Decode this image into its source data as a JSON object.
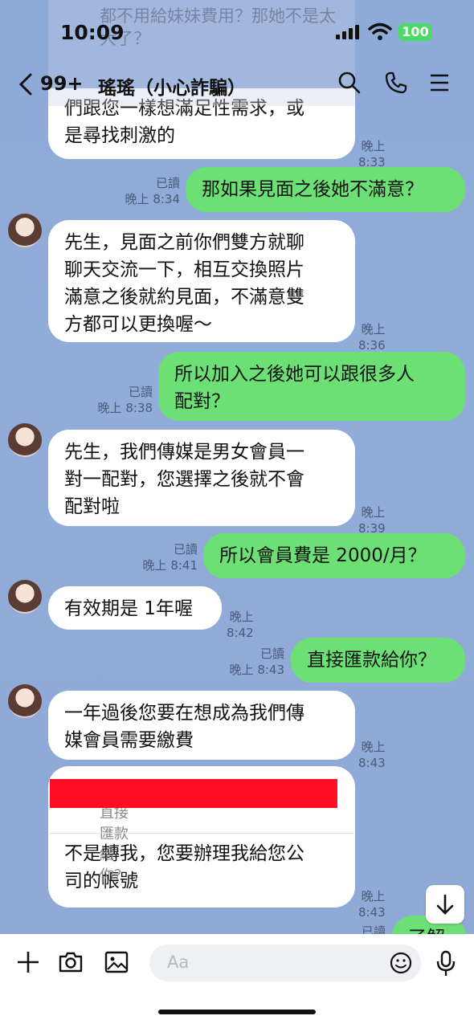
{
  "status_bar": {
    "time": "10:09",
    "battery": "100"
  },
  "header": {
    "unread_count": "99+",
    "title": "瑤瑤（小心詐騙）"
  },
  "ghost_overlay": {
    "text": "都不用給妹妹費用？那她不是太大了？"
  },
  "messages": [
    {
      "side": "left",
      "lines": [
        "們跟您一樣想滿足性需求，或",
        "是尋找刺激的"
      ],
      "time": "晚上 8:33"
    },
    {
      "side": "right",
      "lines": [
        "那如果見面之後她不滿意？"
      ],
      "read": "已讀",
      "time": "晚上 8:34"
    },
    {
      "side": "left",
      "lines": [
        "先生，見面之前你們雙方就聊",
        "聊天交流一下，相互交換照片",
        "滿意之後就約見面，不滿意雙",
        "方都可以更換喔～"
      ],
      "time": "晚上 8:36"
    },
    {
      "side": "right",
      "lines": [
        "所以加入之後她可以跟很多人",
        "配對？"
      ],
      "read": "已讀",
      "time": "晚上 8:38"
    },
    {
      "side": "left",
      "lines": [
        "先生，我們傳媒是男女會員一",
        "對一配對，您選擇之後就不會",
        "配對啦"
      ],
      "time": "晚上 8:39"
    },
    {
      "side": "right",
      "lines": [
        "所以會員費是 2000/月？"
      ],
      "read": "已讀",
      "time": "晚上 8:41"
    },
    {
      "side": "left",
      "lines": [
        "有效期是 1年喔"
      ],
      "time": "晚上 8:42"
    },
    {
      "side": "right",
      "lines": [
        "直接匯款給你？"
      ],
      "read": "已讀",
      "time": "晚上 8:43"
    },
    {
      "side": "left",
      "lines": [
        "一年過後您要在想成為我們傳",
        "媒會員需要繳費"
      ],
      "time": "晚上 8:43"
    },
    {
      "side": "left",
      "quote": "直接匯款給你？",
      "lines": [
        "不是轉我，您要辦理我給您公",
        "司的帳號"
      ],
      "time": "晚上 8:43"
    },
    {
      "side": "right",
      "lines": [
        "了解"
      ],
      "read": "已讀",
      "time": ""
    }
  ],
  "input": {
    "placeholder": "Aa"
  },
  "icons": [
    "back-chevron-icon",
    "search-icon",
    "phone-icon",
    "menu-icon",
    "plus-icon",
    "camera-icon",
    "image-icon",
    "emoji-icon",
    "mic-icon",
    "arrow-down-icon"
  ]
}
